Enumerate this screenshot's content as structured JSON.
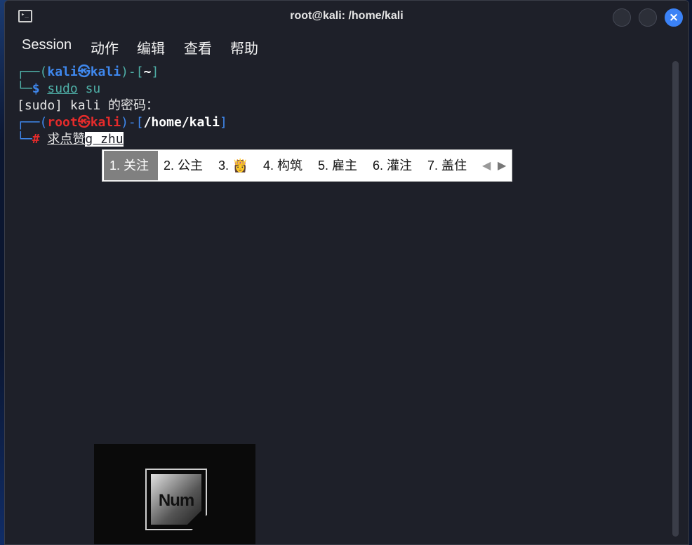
{
  "window": {
    "title": "root@kali: /home/kali",
    "close_glyph": "×",
    "terminal_icon_glyph": "▸_"
  },
  "menu": [
    "Session",
    "动作",
    "编辑",
    "查看",
    "帮助"
  ],
  "terminal": {
    "prompt1_open": "┌──(",
    "prompt1_user": "kali",
    "prompt1_at": "㉿",
    "prompt1_host": "kali",
    "prompt1_mid": ")-[",
    "prompt1_dir": "~",
    "prompt1_close": "]",
    "prompt1_corner": "└─",
    "prompt1_symbol": "$",
    "cmd1_a": "sudo",
    "cmd1_b": " su",
    "sudo_prompt": "[sudo] kali 的密码：",
    "prompt2_open": "┌──(",
    "prompt2_user": "root",
    "prompt2_at": "㉿",
    "prompt2_host": "kali",
    "prompt2_mid": ")-[",
    "prompt2_dir": "/home/kali",
    "prompt2_close": "]",
    "prompt2_corner": "└─",
    "prompt2_symbol": "#",
    "input_committed": "求点赞",
    "input_preedit": "g zhu"
  },
  "ime": {
    "candidates": [
      "1. 关注",
      "2. 公主",
      "3. 👸",
      "4. 构筑",
      "5. 雇主",
      "6. 灌注",
      "7. 盖住"
    ],
    "prev_arrow": "◀",
    "next_arrow": "▶",
    "selected_index": 0
  },
  "osd": {
    "label": "Num"
  }
}
